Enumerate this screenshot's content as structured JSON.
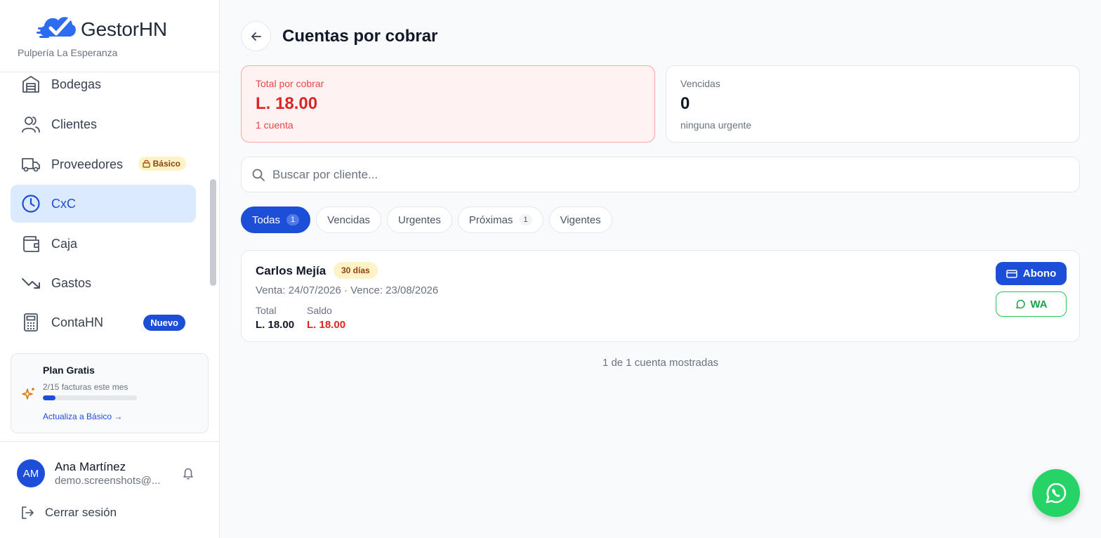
{
  "brand": {
    "name": "GestorHN",
    "business": "Pulpería La Esperanza"
  },
  "sidebar": {
    "items": [
      {
        "label": "Bodegas",
        "icon": "warehouse-icon"
      },
      {
        "label": "Clientes",
        "icon": "users-icon"
      },
      {
        "label": "Proveedores",
        "icon": "truck-icon",
        "badge": "Básico"
      },
      {
        "label": "CxC",
        "icon": "clock-icon",
        "active": true
      },
      {
        "label": "Caja",
        "icon": "wallet-icon"
      },
      {
        "label": "Gastos",
        "icon": "trending-down-icon"
      },
      {
        "label": "ContaHN",
        "icon": "calculator-icon",
        "badge": "Nuevo"
      }
    ]
  },
  "plan": {
    "title": "Plan Gratis",
    "usage": "2/15 facturas este mes",
    "used": 2,
    "limit": 15,
    "upgrade_link": "Actualiza a Básico →"
  },
  "user": {
    "initials": "AM",
    "name": "Ana Martínez",
    "email": "demo.screenshots@...",
    "logout_label": "Cerrar sesión"
  },
  "page": {
    "title": "Cuentas por cobrar"
  },
  "summary": {
    "total": {
      "label": "Total por cobrar",
      "value": "L. 18.00",
      "sub": "1 cuenta"
    },
    "overdue": {
      "label": "Vencidas",
      "value": "0",
      "sub": "ninguna urgente"
    }
  },
  "search": {
    "placeholder": "Buscar por cliente..."
  },
  "filters": [
    {
      "label": "Todas",
      "count": "1",
      "active": true
    },
    {
      "label": "Vencidas"
    },
    {
      "label": "Urgentes"
    },
    {
      "label": "Próximas",
      "count": "1"
    },
    {
      "label": "Vigentes"
    }
  ],
  "accounts": [
    {
      "client": "Carlos Mejía",
      "days": "30 días",
      "dates": "Venta: 24/07/2026 · Vence: 23/08/2026",
      "total_label": "Total",
      "total": "L. 18.00",
      "balance_label": "Saldo",
      "balance": "L. 18.00",
      "pay_button": "Abono",
      "wa_button": "WA"
    }
  ],
  "footer": {
    "count_text": "1 de 1 cuenta mostradas"
  },
  "colors": {
    "primary": "#1d4ed8",
    "danger": "#dc2626",
    "warning_bg": "#fef3c7",
    "whatsapp": "#25d366"
  }
}
